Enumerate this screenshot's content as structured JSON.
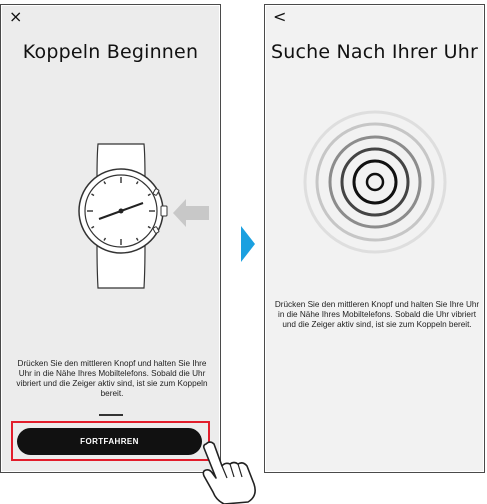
{
  "left_screen": {
    "close_icon": "×",
    "title": "Koppeln Beginnen",
    "description": "Drücken Sie den mittleren Knopf und halten Sie Ihre Uhr in die Nähe Ihres Mobiltelefons. Sobald die Uhr vibriert und die Zeiger aktiv sind, ist sie zum Koppeln bereit.",
    "continue_button": "FORTFAHREN"
  },
  "right_screen": {
    "back_icon": "<",
    "title": "Suche Nach Ihrer Uhr",
    "description": "Drücken Sie den mittleren Knopf und halten Sie Ihre Uhr in die Nähe Ihres Mobiltelefons. Sobald die Uhr vibriert und die Zeiger aktiv sind, ist sie zum Koppeln bereit."
  },
  "colors": {
    "highlight": "#e21d2b",
    "arrow": "#1aa0e0",
    "button": "#111111"
  },
  "icons": [
    "close-icon",
    "back-icon",
    "watch-illustration",
    "arrow-left-icon",
    "signal-rings-icon",
    "hand-pointer-icon",
    "step-arrow-icon"
  ]
}
